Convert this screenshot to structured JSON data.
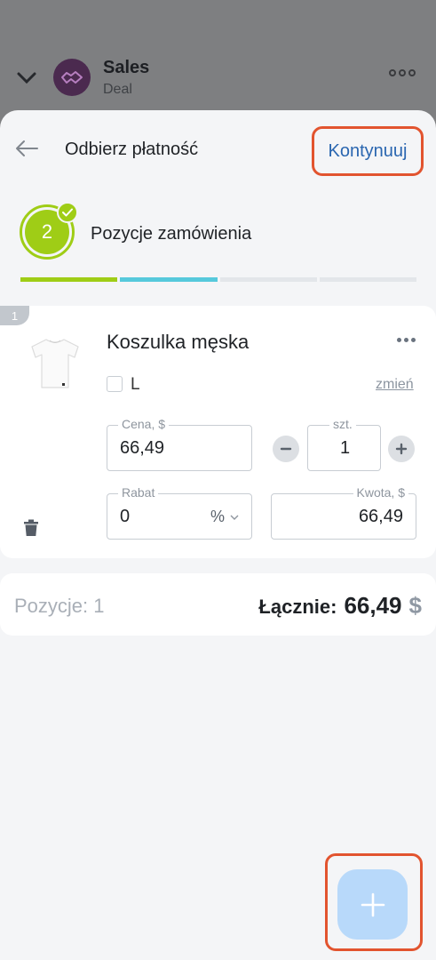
{
  "background_header": {
    "title": "Sales",
    "subtitle": "Deal",
    "avatar_icon": "handshake-icon",
    "menu_icon": "more-horizontal-icon",
    "collapse_icon": "chevron-down-icon"
  },
  "topbar": {
    "back_icon": "arrow-left-icon",
    "title": "Odbierz płatność",
    "continue_label": "Kontynuuj"
  },
  "step": {
    "number": "2",
    "label": "Pozycje zamówienia",
    "completed_icon": "check-icon",
    "progress_colors": [
      "#9fcd16",
      "#56c9dc",
      "#e3e6ea",
      "#e3e6ea"
    ]
  },
  "product": {
    "index": "1",
    "name": "Koszulka męska",
    "image_icon": "tshirt-icon",
    "variant_label": "L",
    "change_label": "zmień",
    "price_label": "Cena, $",
    "price_value": "66,49",
    "qty_label": "szt.",
    "qty_value": "1",
    "discount_label": "Rabat",
    "discount_value": "0",
    "discount_unit": "%",
    "amount_label": "Kwota, $",
    "amount_value": "66,49"
  },
  "summary": {
    "count_text": "Pozycje: 1",
    "total_label": "Łącznie:",
    "total_value": "66,49",
    "currency": "$"
  },
  "fab": {
    "icon": "plus-icon"
  },
  "colors": {
    "accent_green": "#9fcd16",
    "accent_cyan": "#56c9dc",
    "link_blue": "#2a66b0",
    "highlight_red": "#e2542f",
    "fab_blue": "#b8d9fa"
  }
}
